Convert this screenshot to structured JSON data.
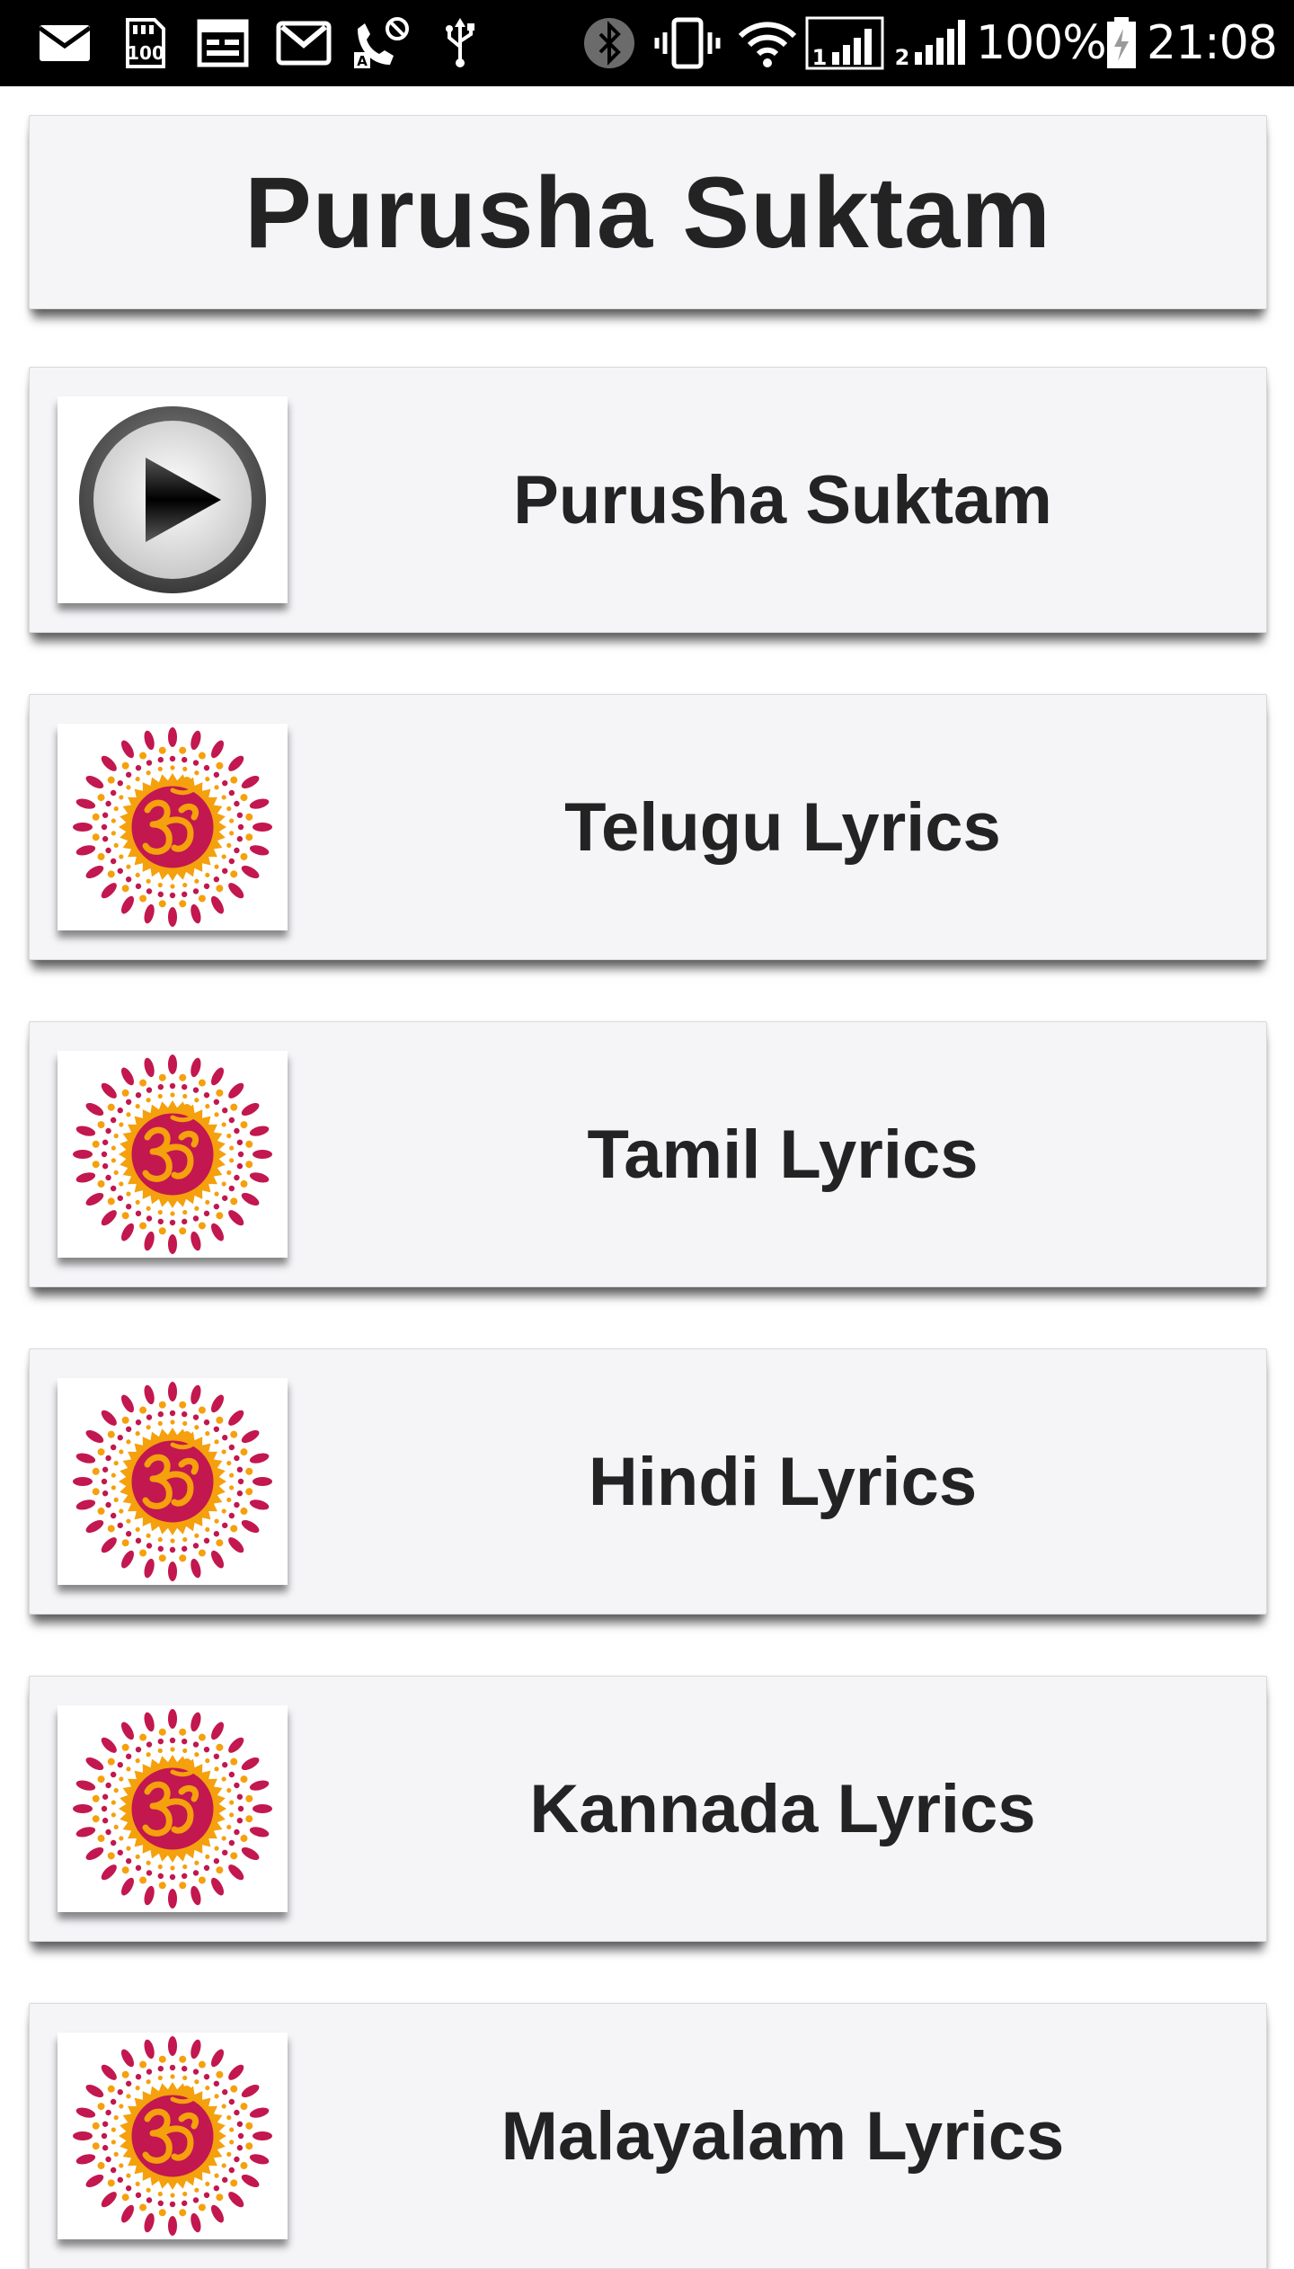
{
  "status_bar": {
    "battery_percent": "100%",
    "time": "21:08",
    "background_color": "#000000",
    "icons": [
      "email-icon",
      "sd-card-100-icon",
      "calendar-icon",
      "gmail-icon",
      "call-blocked-icon",
      "usb-icon",
      "bluetooth-icon",
      "vibrate-icon",
      "wifi-icon",
      "signal-sim1-icon",
      "signal-sim2-icon",
      "battery-charging-icon"
    ]
  },
  "app": {
    "title": "Purusha Suktam",
    "card_background": "#f5f4f7",
    "text_color": "#232323",
    "om_colors": {
      "red": "#c2174f",
      "orange": "#f5a00d"
    }
  },
  "menu": {
    "items": [
      {
        "label": "Purusha Suktam",
        "icon": "play-icon"
      },
      {
        "label": "Telugu Lyrics",
        "icon": "om-icon"
      },
      {
        "label": "Tamil Lyrics",
        "icon": "om-icon"
      },
      {
        "label": "Hindi Lyrics",
        "icon": "om-icon"
      },
      {
        "label": "Kannada Lyrics",
        "icon": "om-icon"
      },
      {
        "label": "Malayalam Lyrics",
        "icon": "om-icon"
      }
    ]
  }
}
